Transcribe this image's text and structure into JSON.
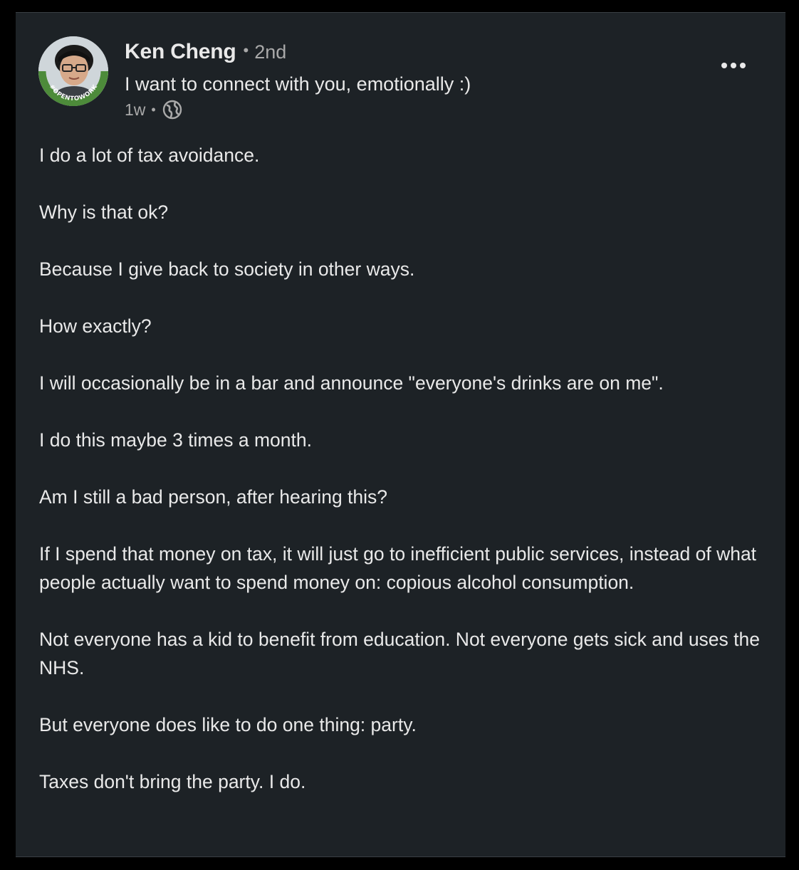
{
  "post": {
    "author": {
      "name": "Ken Cheng",
      "separator": "•",
      "degree": "2nd",
      "headline": "I want to connect with you, emotionally :)",
      "time": "1w",
      "meta_separator": "•",
      "visibility_icon": "globe-icon",
      "avatar_badge": "#OPENTOWORK"
    },
    "menu_icon": "more-horizontal-icon",
    "paragraphs": [
      "I do a lot of tax avoidance.",
      "Why is that ok?",
      "Because I give back to society in other ways.",
      "How exactly?",
      "I will occasionally be in a bar and announce \"everyone's drinks are on me\".",
      "I do this maybe 3 times a month.",
      "Am I still a bad person, after hearing this?",
      "If I spend that money on tax, it will just go to inefficient public services, instead of what people actually want to spend money on: copious alcohol consumption.",
      "Not everyone has a kid to benefit from education. Not everyone gets sick and uses the NHS.",
      "But everyone does like to do one thing: party.",
      "Taxes don't bring the party. I do."
    ]
  },
  "colors": {
    "page_background": "#000000",
    "card_background": "#1d2226",
    "primary_text": "#e9e9e9",
    "secondary_text": "#a9a9a9",
    "open_to_work_green": "#4d8b3a"
  }
}
